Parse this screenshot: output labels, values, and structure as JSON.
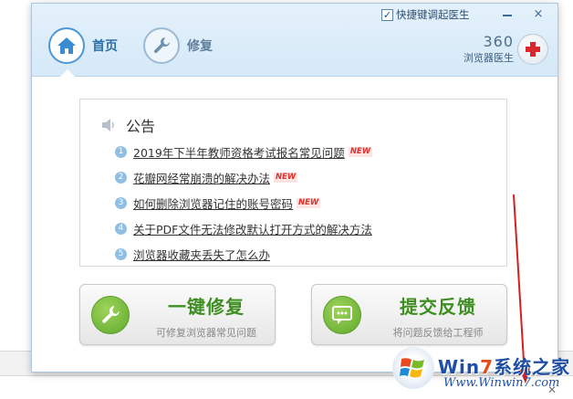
{
  "window": {
    "shortcut_checked": true,
    "shortcut_label": "快捷键调起医生",
    "minimize_label": "",
    "close_label": "×"
  },
  "nav": {
    "home_label": "首页",
    "repair_label": "修复"
  },
  "brand": {
    "number": "360",
    "subtitle": "浏览器医生"
  },
  "notice": {
    "title": "公告",
    "items": [
      {
        "num": "1",
        "text": "2019年下半年教师资格考试报名常见问题",
        "badge": "NEW"
      },
      {
        "num": "2",
        "text": "花瓣网经常崩溃的解决办法",
        "badge": "NEW"
      },
      {
        "num": "3",
        "text": "如何删除浏览器记住的账号密码",
        "badge": "NEW"
      },
      {
        "num": "4",
        "text": "关于PDF文件无法修改默认打开方式的解决方法",
        "badge": ""
      },
      {
        "num": "5",
        "text": "浏览器收藏夹丢失了怎么办",
        "badge": ""
      }
    ]
  },
  "actions": {
    "repair": {
      "title": "一键修复",
      "subtitle": "可修复浏览器常见问题"
    },
    "feedback": {
      "title": "提交反馈",
      "subtitle": "将问题反馈给工程师"
    }
  },
  "watermark": {
    "title_prefix": "Win",
    "title_seven": "7",
    "title_suffix": "系统之家",
    "url": "Www.Winwin7.com"
  },
  "tray": {
    "close_glyph": "✕"
  },
  "colors": {
    "accent_blue": "#2a6fab",
    "header_bg": "#d5e9f8",
    "action_green": "#3e8e22",
    "badge_red": "#e0332f",
    "arrow_red": "#d42020"
  },
  "icons": {
    "home": "home-icon",
    "repair": "wrench-icon",
    "brand": "red-cross-icon",
    "notice": "speaker-icon",
    "feedback": "chat-bubble-icon"
  }
}
